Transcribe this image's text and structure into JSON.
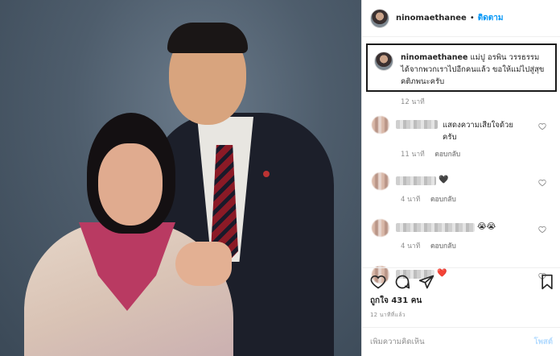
{
  "header": {
    "username": "ninomaethanee",
    "separator": "•",
    "follow_label": "ติดตาม"
  },
  "caption": {
    "username": "ninomaethanee",
    "text": "แม่ปู อรพิน วรรธรรม ได้จากพวกเราไปอีกคนแล้ว ขอให้แม่ไปสู่สุขคติภพนะครับ",
    "time": "12 นาที"
  },
  "comments": [
    {
      "text": "แสดงความเสียใจด้วยครับ",
      "time": "11 นาที",
      "reply_label": "ตอบกลับ",
      "emoji": ""
    },
    {
      "text": "",
      "time": "4 นาที",
      "reply_label": "ตอบกลับ",
      "emoji": "🖤"
    },
    {
      "text": "",
      "time": "4 นาที",
      "reply_label": "ตอบกลับ",
      "emoji": "😭😭"
    },
    {
      "text": "",
      "time": "",
      "reply_label": "",
      "emoji": "❤️"
    }
  ],
  "likes": {
    "label": "ถูกใจ 431 คน"
  },
  "posted": "12 นาทีที่แล้ว",
  "add_comment": {
    "placeholder": "เพิ่มความคิดเห็น",
    "post_label": "โพสต์"
  },
  "icons": {
    "like": "heart-icon",
    "comment": "comment-icon",
    "share": "share-icon",
    "save": "bookmark-icon"
  },
  "colors": {
    "accent": "#0095f6",
    "muted": "#8e8e8e",
    "post_disabled": "#b3dbff",
    "heart_red": "#ed4956"
  }
}
